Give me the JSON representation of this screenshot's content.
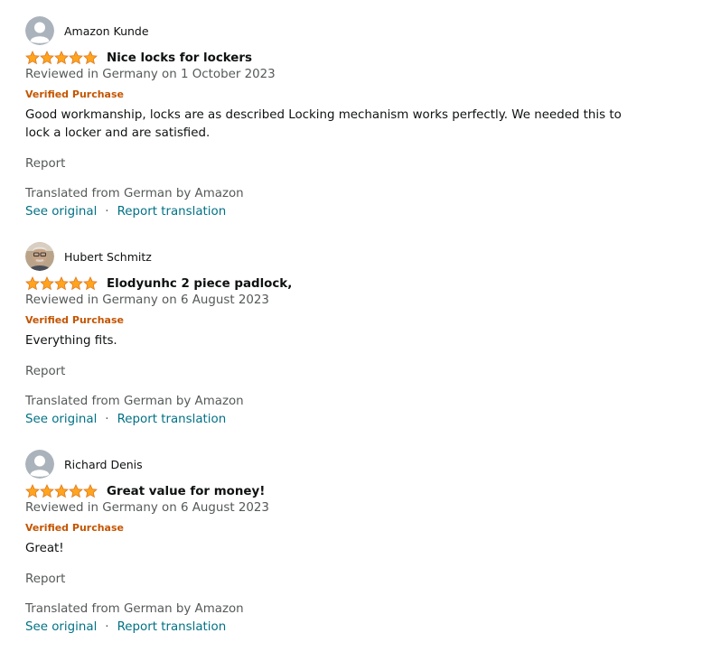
{
  "colors": {
    "star": "#ffa41c",
    "verified": "#c45500",
    "link": "#007185",
    "secondary_text": "#565959"
  },
  "reviews": [
    {
      "profile_name": "Amazon Kunde",
      "avatar": "default-avatar-icon",
      "rating": 5,
      "title": "Nice locks for lockers",
      "date": "Reviewed in Germany on 1 October 2023",
      "verified": "Verified Purchase",
      "body": "Good workmanship, locks are as described Locking mechanism works perfectly. We needed this to lock a locker and are satisfied.",
      "report": "Report",
      "translated": "Translated from German by Amazon",
      "see_original": "See original",
      "separator": "·",
      "report_translation": "Report translation"
    },
    {
      "profile_name": "Hubert Schmitz",
      "avatar": "photo-avatar",
      "rating": 5,
      "title": "Elodyunhc 2 piece padlock,",
      "date": "Reviewed in Germany on 6 August 2023",
      "verified": "Verified Purchase",
      "body": "Everything fits.",
      "report": "Report",
      "translated": "Translated from German by Amazon",
      "see_original": "See original",
      "separator": "·",
      "report_translation": "Report translation"
    },
    {
      "profile_name": "Richard Denis",
      "avatar": "default-avatar-icon",
      "rating": 5,
      "title": "Great value for money!",
      "date": "Reviewed in Germany on 6 August 2023",
      "verified": "Verified Purchase",
      "body": "Great!",
      "report": "Report",
      "translated": "Translated from German by Amazon",
      "see_original": "See original",
      "separator": "·",
      "report_translation": "Report translation"
    }
  ]
}
